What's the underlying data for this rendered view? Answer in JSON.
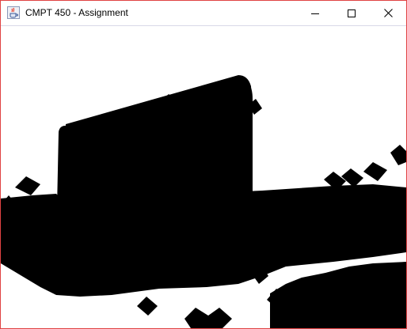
{
  "window": {
    "title": "CMPT 450 - Assignment",
    "border_color": "#e04343"
  },
  "icons": {
    "app": "java-coffee-cup-icon",
    "minimize": "minimize-icon",
    "maximize": "maximize-icon",
    "close": "close-icon"
  },
  "canvas": {
    "background": "#ffffff",
    "fill": "#000000"
  }
}
